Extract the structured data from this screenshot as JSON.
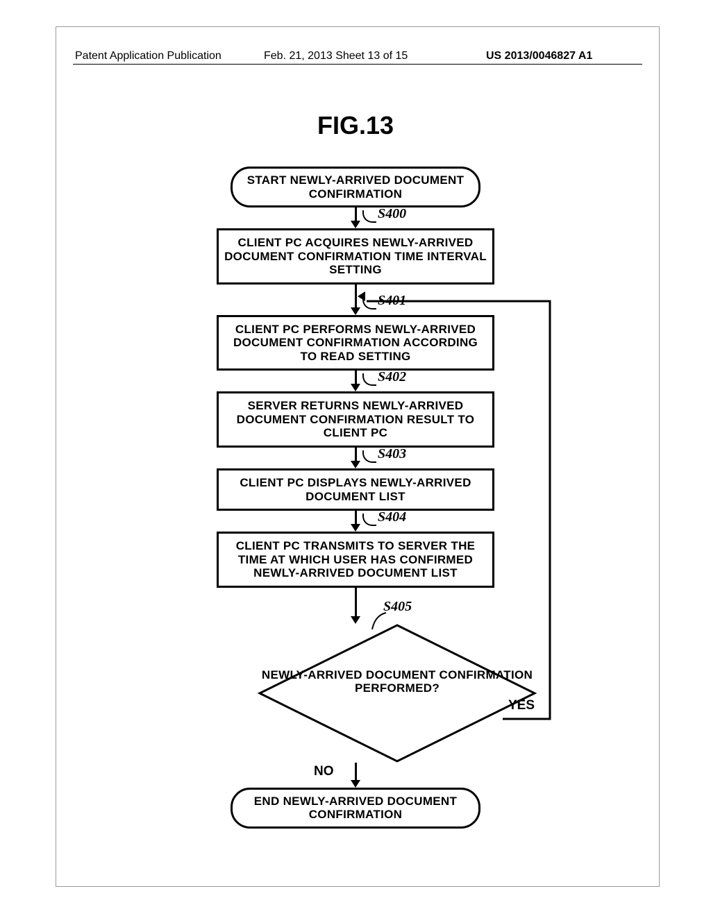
{
  "header": {
    "left": "Patent Application Publication",
    "center": "Feb. 21, 2013  Sheet 13 of 15",
    "right": "US 2013/0046827 A1"
  },
  "figure_title": "FIG.13",
  "steps": {
    "start": "START NEWLY-ARRIVED DOCUMENT CONFIRMATION",
    "s400": "CLIENT PC ACQUIRES NEWLY-ARRIVED DOCUMENT CONFIRMATION TIME INTERVAL SETTING",
    "s401": "CLIENT PC PERFORMS NEWLY-ARRIVED DOCUMENT CONFIRMATION ACCORDING TO READ SETTING",
    "s402": "SERVER RETURNS NEWLY-ARRIVED DOCUMENT CONFIRMATION RESULT TO CLIENT PC",
    "s403": "CLIENT PC DISPLAYS NEWLY-ARRIVED DOCUMENT LIST",
    "s404": "CLIENT PC TRANSMITS TO SERVER THE TIME AT WHICH USER HAS CONFIRMED NEWLY-ARRIVED DOCUMENT LIST",
    "decision": "NEWLY-ARRIVED DOCUMENT CONFIRMATION PERFORMED?",
    "end": "END NEWLY-ARRIVED DOCUMENT CONFIRMATION"
  },
  "labels": {
    "s400": "S400",
    "s401": "S401",
    "s402": "S402",
    "s403": "S403",
    "s404": "S404",
    "s405": "S405",
    "yes": "YES",
    "no": "NO"
  }
}
